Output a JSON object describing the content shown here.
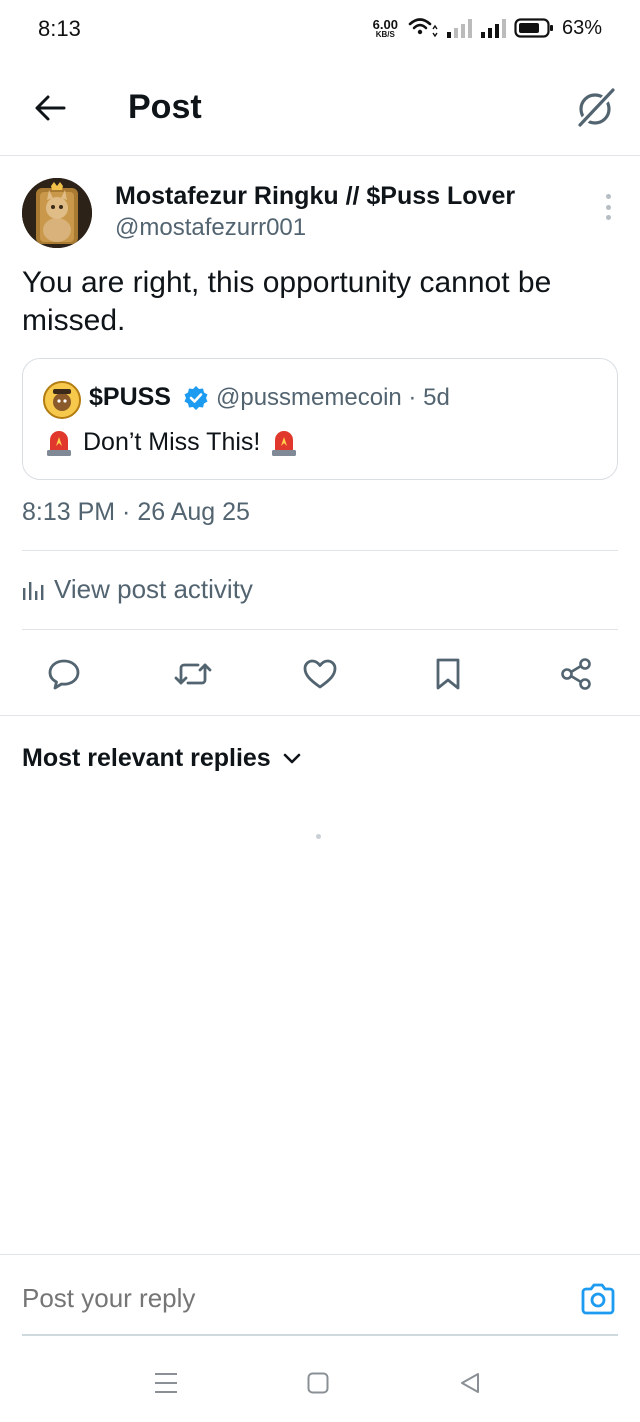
{
  "status_bar": {
    "time": "8:13",
    "net_speed_value": "6.00",
    "net_speed_unit": "KB/S",
    "battery_percent": "63%"
  },
  "header": {
    "title": "Post",
    "back_icon": "arrow-left-icon",
    "grok_icon": "grok-icon"
  },
  "post": {
    "author_name": "Mostafezur Ringku // $Puss Lover",
    "author_handle": "@mostafezurr001",
    "text": "You are right, this opportunity cannot be missed.",
    "quote": {
      "name": "$PUSS",
      "handle_and_age": "@pussmemecoin · 5d",
      "text": "Don’t Miss This!"
    },
    "timestamp": "8:13 PM · 26 Aug 25",
    "activity_label": "View post activity"
  },
  "actions": [
    "reply-icon",
    "repost-icon",
    "like-icon",
    "bookmark-icon",
    "share-icon"
  ],
  "replies": {
    "sort_label": "Most relevant replies"
  },
  "reply_bar": {
    "placeholder": "Post your reply"
  },
  "colors": {
    "text": "#0f1419",
    "muted": "#536471",
    "accent": "#1d9bf0",
    "border": "#e1e4e8"
  }
}
